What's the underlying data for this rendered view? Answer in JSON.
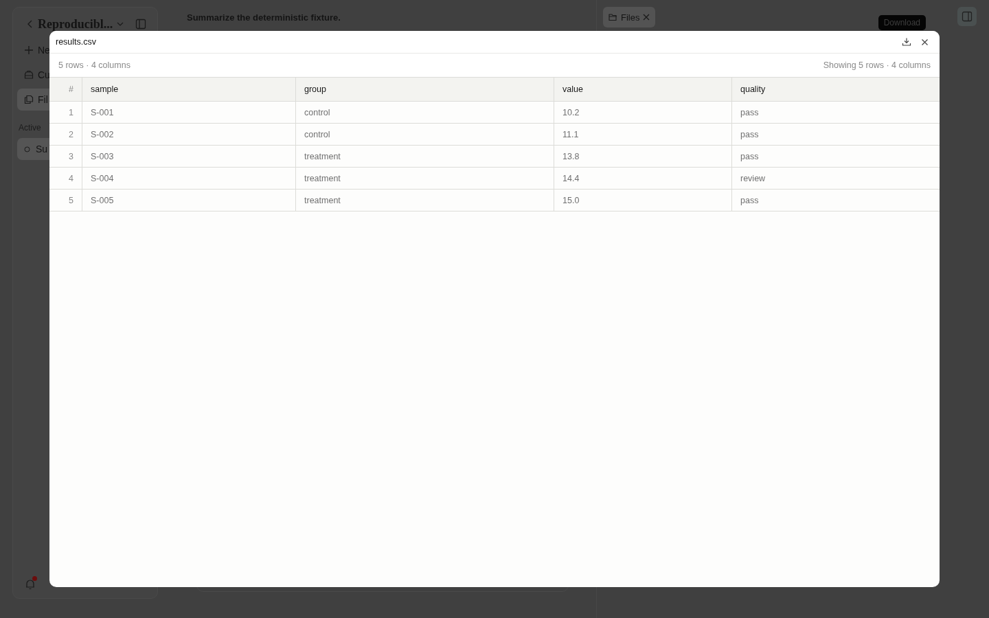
{
  "sidebar": {
    "title": "Reproducibl...",
    "items": [
      {
        "kind": "plus",
        "label": "Ne",
        "selected": false
      },
      {
        "kind": "toolbox",
        "label": "Cu",
        "selected": false
      },
      {
        "kind": "files",
        "label": "Fil",
        "selected": true
      }
    ],
    "section": "Active",
    "conversations": [
      {
        "label": "Su",
        "selected": true
      }
    ],
    "notifications": {
      "unread": true
    }
  },
  "main": {
    "prompt": "Summarize the deterministic fixture."
  },
  "panel": {
    "tabs": [
      {
        "label": "Files",
        "selected": true
      }
    ]
  },
  "tooltip": "Download",
  "dialog": {
    "title": "results.csv",
    "summary": "5 rows · 4 columns",
    "showing": "Showing 5 rows · 4 columns",
    "table": {
      "columns": [
        "#",
        "sample",
        "group",
        "value",
        "quality"
      ],
      "rows": [
        [
          "1",
          "S-001",
          "control",
          "10.2",
          "pass"
        ],
        [
          "2",
          "S-002",
          "control",
          "11.1",
          "pass"
        ],
        [
          "3",
          "S-003",
          "treatment",
          "13.8",
          "pass"
        ],
        [
          "4",
          "S-004",
          "treatment",
          "14.4",
          "review"
        ],
        [
          "5",
          "S-005",
          "treatment",
          "15.0",
          "pass"
        ]
      ]
    }
  }
}
